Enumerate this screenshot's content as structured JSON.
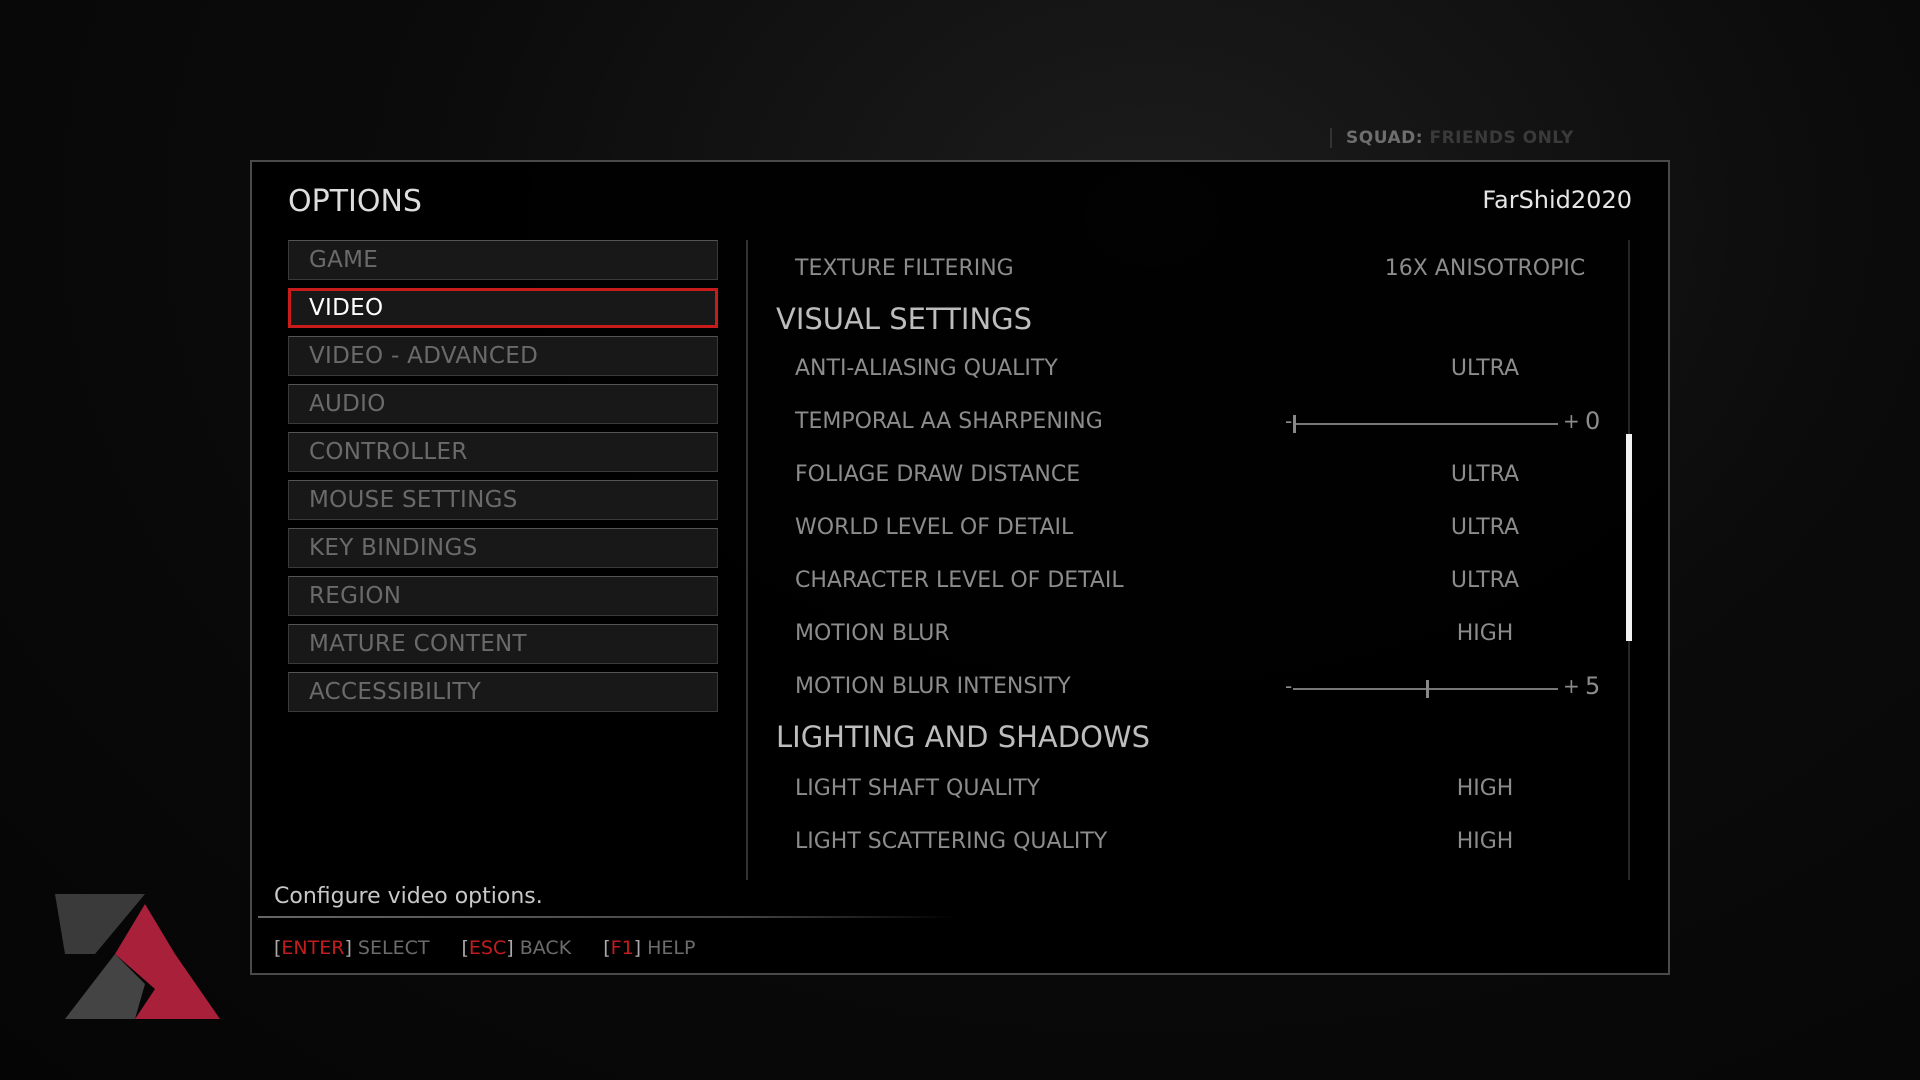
{
  "squad": {
    "label": "SQUAD:",
    "value": "FRIENDS ONLY"
  },
  "header": {
    "title": "OPTIONS",
    "username": "FarShid2020"
  },
  "menu": [
    {
      "label": "GAME"
    },
    {
      "label": "VIDEO",
      "active": true
    },
    {
      "label": "VIDEO - ADVANCED"
    },
    {
      "label": "AUDIO"
    },
    {
      "label": "CONTROLLER"
    },
    {
      "label": "MOUSE SETTINGS"
    },
    {
      "label": "KEY BINDINGS"
    },
    {
      "label": "REGION"
    },
    {
      "label": "MATURE CONTENT"
    },
    {
      "label": "ACCESSIBILITY"
    }
  ],
  "settings": {
    "texture_filtering": {
      "label": "TEXTURE FILTERING",
      "value": "16X ANISOTROPIC"
    },
    "visual_heading": "VISUAL SETTINGS",
    "aa_quality": {
      "label": "ANTI-ALIASING QUALITY",
      "value": "ULTRA"
    },
    "temporal_aa": {
      "label": "TEMPORAL AA SHARPENING",
      "value": "0",
      "min": 0,
      "max": 10
    },
    "foliage": {
      "label": "FOLIAGE DRAW DISTANCE",
      "value": "ULTRA"
    },
    "world_lod": {
      "label": "WORLD LEVEL OF DETAIL",
      "value": "ULTRA"
    },
    "char_lod": {
      "label": "CHARACTER LEVEL OF DETAIL",
      "value": "ULTRA"
    },
    "motion_blur": {
      "label": "MOTION BLUR",
      "value": "HIGH"
    },
    "motion_blur_intensity": {
      "label": "MOTION BLUR INTENSITY",
      "value": "5",
      "min": 0,
      "max": 10
    },
    "lighting_heading": "LIGHTING AND SHADOWS",
    "light_shaft": {
      "label": "LIGHT SHAFT QUALITY",
      "value": "HIGH"
    },
    "light_scattering": {
      "label": "LIGHT SCATTERING QUALITY",
      "value": "HIGH"
    }
  },
  "slider_symbols": {
    "minus": "-",
    "plus": "+"
  },
  "description": "Configure video options.",
  "footer": [
    {
      "key": "ENTER",
      "action": "SELECT"
    },
    {
      "key": "ESC",
      "action": "BACK"
    },
    {
      "key": "F1",
      "action": "HELP"
    }
  ],
  "colors": {
    "accent": "#c81b1b",
    "panel": "#000000",
    "text": "#8c8c8c"
  }
}
